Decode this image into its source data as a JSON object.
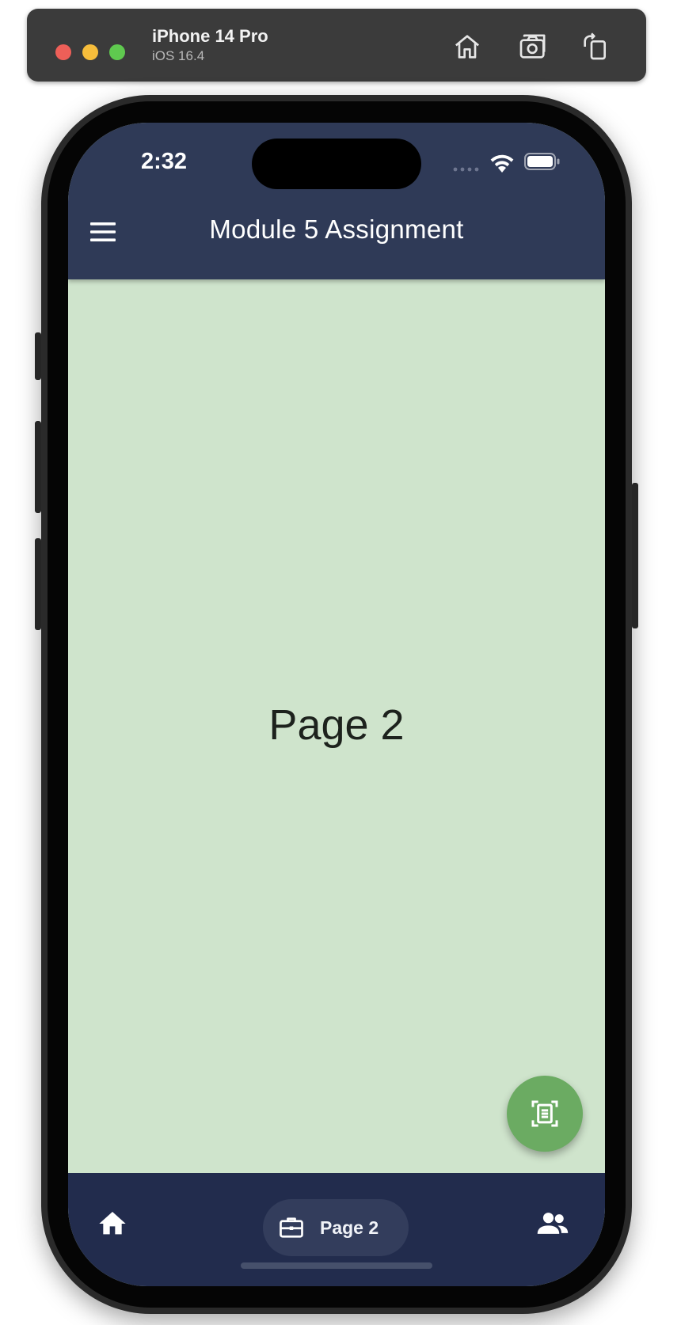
{
  "simulator": {
    "device_name": "iPhone 14 Pro",
    "os_version": "iOS 16.4",
    "icons": [
      "home-icon",
      "screenshot-icon",
      "rotate-icon"
    ]
  },
  "status_bar": {
    "time": "2:32",
    "icons": [
      "cellular-signal-icon",
      "wifi-icon",
      "battery-icon"
    ]
  },
  "app_bar": {
    "menu_icon": "menu-icon",
    "title": "Module 5 Assignment"
  },
  "body": {
    "page_label": "Page 2"
  },
  "fab": {
    "icon": "document-scanner-icon"
  },
  "bottom_nav": {
    "items": [
      {
        "icon": "home-icon",
        "label": "",
        "selected": false
      },
      {
        "icon": "briefcase-icon",
        "label": "Page 2",
        "selected": true
      },
      {
        "icon": "people-icon",
        "label": "",
        "selected": false
      }
    ]
  },
  "colors": {
    "app_bar": "#2f3a57",
    "body_background": "#cfe4cc",
    "fab": "#6bab62",
    "bottom_nav": "#222c4d",
    "selected_pill": "#333d5c"
  }
}
